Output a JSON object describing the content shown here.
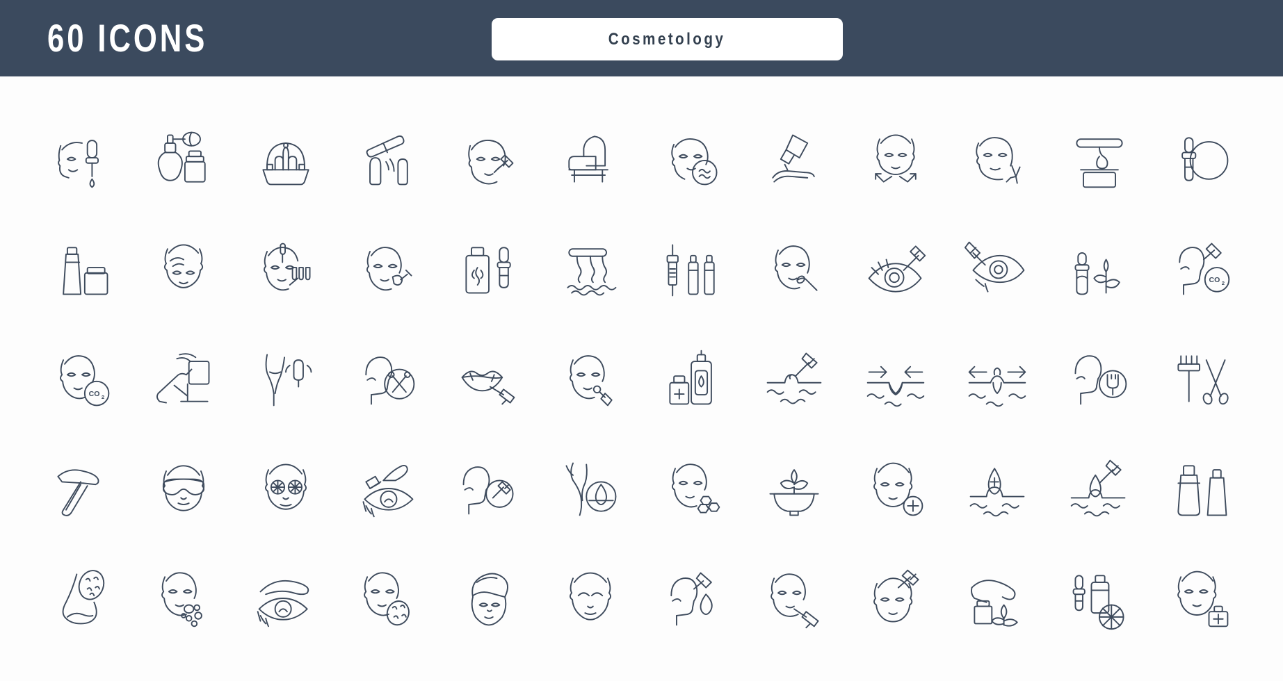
{
  "header": {
    "title": "60 ICONS",
    "badge_label": "Cosmetology",
    "background_color": "#3b4a5e",
    "badge_background_color": "#ffffff",
    "badge_text_color": "#33404f",
    "title_color": "#ffffff"
  },
  "grid": {
    "columns": 12,
    "rows": 5,
    "total_icons": 60,
    "icon_stroke_color": "#3d4a5c",
    "page_background_color": "#ffffff"
  },
  "icons": [
    {
      "index": 1,
      "name": "face-dropper-serum-icon",
      "label": "Face with dropper serum"
    },
    {
      "index": 2,
      "name": "perfume-atomizer-bottle-icon",
      "label": "Perfume atomizer and bottle"
    },
    {
      "index": 3,
      "name": "cosmetics-basket-icon",
      "label": "Basket of cosmetics"
    },
    {
      "index": 4,
      "name": "nail-polish-file-icon",
      "label": "Nail file and polish"
    },
    {
      "index": 5,
      "name": "face-injection-cheek-icon",
      "label": "Face with cheek injection"
    },
    {
      "index": 6,
      "name": "cosmetology-chair-icon",
      "label": "Cosmetology chair"
    },
    {
      "index": 7,
      "name": "face-acne-analysis-icon",
      "label": "Face with acne analysis circle"
    },
    {
      "index": 8,
      "name": "hand-laser-treatment-icon",
      "label": "Laser treatment on hand"
    },
    {
      "index": 9,
      "name": "face-lifting-arrows-icon",
      "label": "Face lifting with arrows"
    },
    {
      "index": 10,
      "name": "face-sparkle-glow-icon",
      "label": "Face with glow sparkle"
    },
    {
      "index": 11,
      "name": "wax-heater-jar-icon",
      "label": "Wax heater with jar"
    },
    {
      "index": 12,
      "name": "dropper-round-mirror-icon",
      "label": "Dropper with round mirror"
    },
    {
      "index": 13,
      "name": "cream-tube-jar-icon",
      "label": "Cream tube and jar"
    },
    {
      "index": 14,
      "name": "face-mask-relax-icon",
      "label": "Face with relaxing mask"
    },
    {
      "index": 15,
      "name": "face-microneedling-icon",
      "label": "Face microneedling with needles"
    },
    {
      "index": 16,
      "name": "face-brush-application-icon",
      "label": "Face with brush application"
    },
    {
      "index": 17,
      "name": "serum-bottle-pipette-icon",
      "label": "Serum bottle with pipette"
    },
    {
      "index": 18,
      "name": "hair-removal-laser-icon",
      "label": "Laser hair removal on skin"
    },
    {
      "index": 19,
      "name": "syringe-ampoules-icon",
      "label": "Syringe with ampoules"
    },
    {
      "index": 20,
      "name": "face-cotton-swab-icon",
      "label": "Face with cotton swab"
    },
    {
      "index": 21,
      "name": "eye-injection-icon",
      "label": "Eye with injection"
    },
    {
      "index": 22,
      "name": "eyelid-injection-icon",
      "label": "Eyelid with injection"
    },
    {
      "index": 23,
      "name": "natural-serum-leaf-icon",
      "label": "Natural serum dropper with leaves"
    },
    {
      "index": 24,
      "name": "face-co2-therapy-icon",
      "label": "Face profile with CO2 therapy"
    },
    {
      "index": 25,
      "name": "face-co2-injection-icon",
      "label": "Face with CO2 injection"
    },
    {
      "index": 26,
      "name": "cosmetology-bed-lamp-icon",
      "label": "Cosmetology bed with lamp"
    },
    {
      "index": 27,
      "name": "armpit-laser-epilation-icon",
      "label": "Armpit laser epilation"
    },
    {
      "index": 28,
      "name": "hair-cut-scissors-icon",
      "label": "Head profile with scissors"
    },
    {
      "index": 29,
      "name": "lip-filler-injection-icon",
      "label": "Lip filler injection"
    },
    {
      "index": 30,
      "name": "face-applicator-icon",
      "label": "Face with applicator tool"
    },
    {
      "index": 31,
      "name": "lotion-dispenser-kit-icon",
      "label": "Lotion dispenser with first-aid kit"
    },
    {
      "index": 32,
      "name": "pore-injection-skin-icon",
      "label": "Injection into skin pore"
    },
    {
      "index": 33,
      "name": "pore-cleansing-arrows-icon",
      "label": "Pore cleansing inward arrows"
    },
    {
      "index": 34,
      "name": "pore-extraction-arrows-icon",
      "label": "Pore extraction outward arrows"
    },
    {
      "index": 35,
      "name": "head-electrode-therapy-icon",
      "label": "Head profile with electrode therapy"
    },
    {
      "index": 36,
      "name": "brush-tweezers-tools-icon",
      "label": "Brush and tweezers tools"
    },
    {
      "index": 37,
      "name": "straight-razor-icon",
      "label": "Straight razor"
    },
    {
      "index": 38,
      "name": "face-protective-goggles-icon",
      "label": "Face with protective goggles"
    },
    {
      "index": 39,
      "name": "face-cucumber-eyes-icon",
      "label": "Face with cucumber slices on eyes"
    },
    {
      "index": 40,
      "name": "eyelash-extension-icon",
      "label": "Eyelash extension with tweezers"
    },
    {
      "index": 41,
      "name": "head-injection-profile-icon",
      "label": "Head profile with injection"
    },
    {
      "index": 42,
      "name": "leg-hair-removal-icon",
      "label": "Leg hair removal treatment"
    },
    {
      "index": 43,
      "name": "face-molecule-therapy-icon",
      "label": "Face with molecule therapy"
    },
    {
      "index": 44,
      "name": "mortar-leaf-natural-icon",
      "label": "Mortar with natural leaves"
    },
    {
      "index": 45,
      "name": "face-plus-treatment-icon",
      "label": "Face with plus treatment badge"
    },
    {
      "index": 46,
      "name": "skin-hydration-drop-icon",
      "label": "Skin hydration drop injection"
    },
    {
      "index": 47,
      "name": "skin-mesotherapy-drop-icon",
      "label": "Mesotherapy drop into skin"
    },
    {
      "index": 48,
      "name": "shaker-cream-tube-icon",
      "label": "Shaker bottle and cream tube"
    },
    {
      "index": 49,
      "name": "nose-pores-magnify-icon",
      "label": "Nose with magnified pores"
    },
    {
      "index": 50,
      "name": "face-acne-spots-icon",
      "label": "Face with acne spots"
    },
    {
      "index": 51,
      "name": "eyebrow-shaping-icon",
      "label": "Eyebrow shaping over eye"
    },
    {
      "index": 52,
      "name": "face-pore-magnify-icon",
      "label": "Face with magnified pores"
    },
    {
      "index": 53,
      "name": "face-hair-towel-icon",
      "label": "Face with hair towel wrap"
    },
    {
      "index": 54,
      "name": "face-relaxed-eyes-closed-icon",
      "label": "Relaxed face with eyes closed"
    },
    {
      "index": 55,
      "name": "head-hair-serum-drop-icon",
      "label": "Head profile with hair serum drop"
    },
    {
      "index": 56,
      "name": "lip-injection-face-icon",
      "label": "Face with lip injection"
    },
    {
      "index": 57,
      "name": "forehead-injection-icon",
      "label": "Forehead botox injection"
    },
    {
      "index": 58,
      "name": "hand-cream-leaf-icon",
      "label": "Hand with cream jar and leaf"
    },
    {
      "index": 59,
      "name": "dropper-bottle-citrus-icon",
      "label": "Dropper bottle with citrus slice"
    },
    {
      "index": 60,
      "name": "face-medical-kit-icon",
      "label": "Face with medical kit badge"
    }
  ]
}
